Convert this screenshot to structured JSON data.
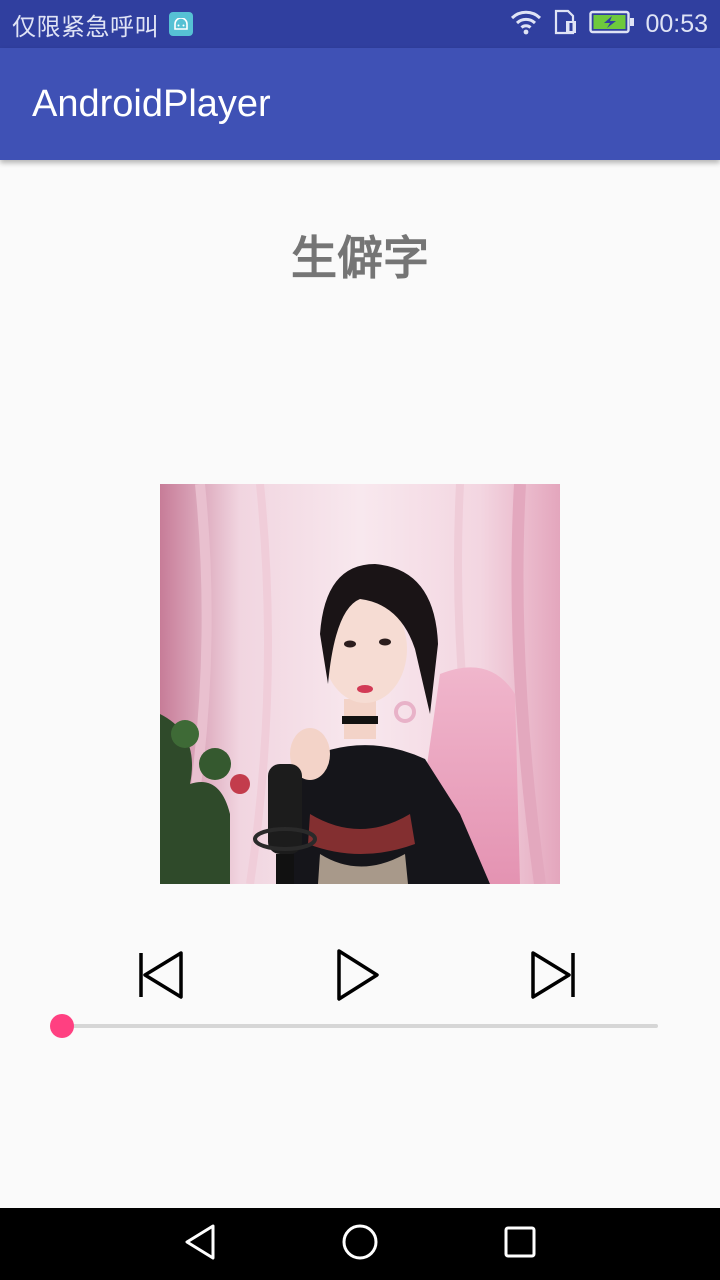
{
  "status_bar": {
    "carrier_text": "仅限紧急呼叫",
    "time": "00:53",
    "icons": [
      "android-notification-icon",
      "wifi-icon",
      "sim-icon",
      "battery-charging-icon"
    ]
  },
  "app_bar": {
    "title": "AndroidPlayer"
  },
  "song": {
    "title": "生僻字"
  },
  "controls": {
    "icons": [
      "skip-previous-icon",
      "play-icon",
      "skip-next-icon"
    ]
  },
  "seek": {
    "progress": 0
  },
  "nav_bar": {
    "icons": [
      "back-icon",
      "home-icon",
      "recents-icon"
    ]
  },
  "colors": {
    "status_bar": "#303f9f",
    "app_bar": "#3f51b5",
    "accent": "#ff4081",
    "background": "#fafafa"
  }
}
